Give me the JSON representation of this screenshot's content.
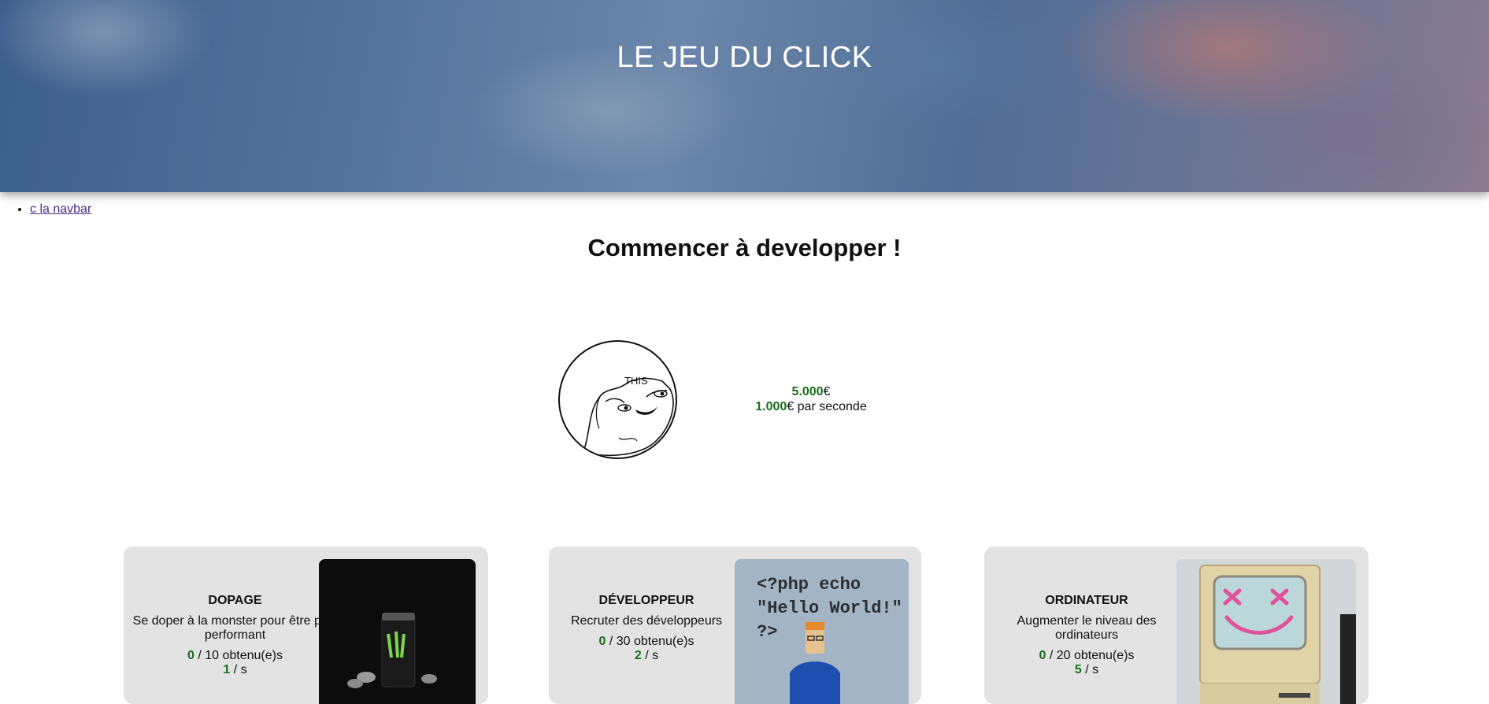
{
  "header": {
    "title": "LE JEU DU CLICK"
  },
  "nav": {
    "items": [
      {
        "label": "c la navbar"
      }
    ]
  },
  "main": {
    "heading": "Commencer à developper !",
    "clicker": {
      "icon": "this-meme-face-icon",
      "caption": "THIS"
    },
    "stats": {
      "money_value": "5.000",
      "money_unit": "€",
      "rate_value": "1.000",
      "rate_suffix": "€ par seconde"
    }
  },
  "upgrades": [
    {
      "title": "DOPAGE",
      "description": "Se doper à la monster pour être plus performant",
      "owned": "0",
      "owned_suffix": " / 10 obtenu(e)s",
      "per_second": "1",
      "per_second_suffix": " / s",
      "image_icon": "energy-drink-can-icon"
    },
    {
      "title": "DÉVELOPPEUR",
      "description": "Recruter des développeurs",
      "owned": "0",
      "owned_suffix": " / 30 obtenu(e)s",
      "per_second": "2",
      "per_second_suffix": " / s",
      "image_icon": "php-developer-figure-icon",
      "image_text": [
        "<?php echo",
        "\"Hello World!\"",
        "?>"
      ]
    },
    {
      "title": "ORDINATEUR",
      "description": "Augmenter le niveau des ordinateurs",
      "owned": "0",
      "owned_suffix": " / 20 obtenu(e)s",
      "per_second": "5",
      "per_second_suffix": " / s",
      "image_icon": "retro-computer-icon"
    }
  ]
}
